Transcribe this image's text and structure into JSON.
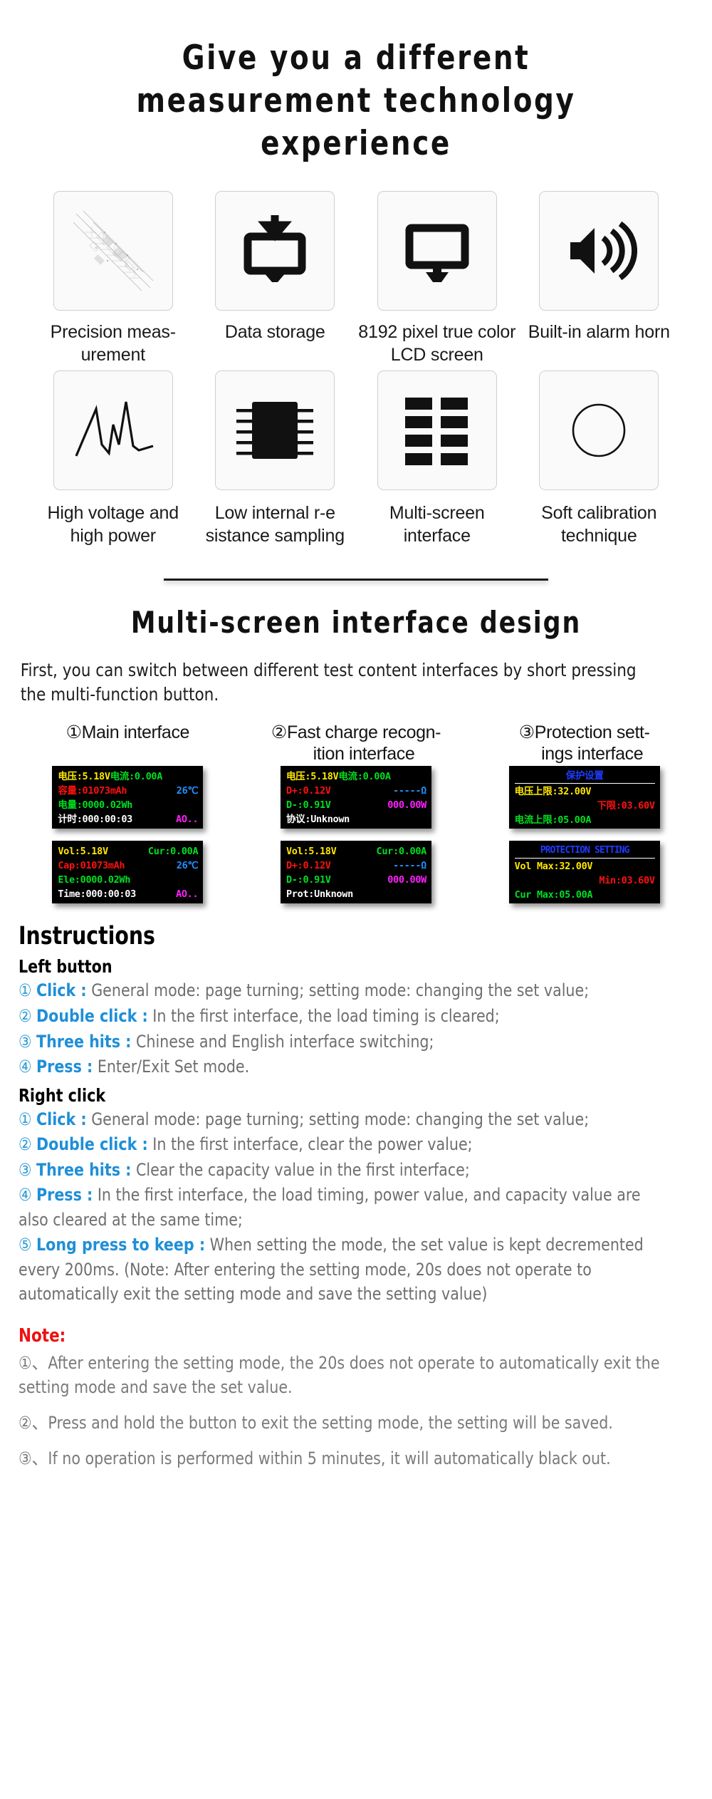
{
  "hero": {
    "title": "Give you a different measurement technology experience"
  },
  "features": [
    {
      "icon": "schematic-drawing-icon",
      "label": "Precision meas-\nurement"
    },
    {
      "icon": "monitor-download-icon",
      "label": "Data storage"
    },
    {
      "icon": "monitor-icon",
      "label": "8192 pixel true\ncolor LCD screen"
    },
    {
      "icon": "speaker-alarm-icon",
      "label": "Built-in alarm\nhorn"
    },
    {
      "icon": "waveform-chart-icon",
      "label": "High voltage and\nhigh power"
    },
    {
      "icon": "ic-chip-icon",
      "label": "Low internal r-e\nsistance sampling"
    },
    {
      "icon": "grid-tiles-icon",
      "label": "Multi-screen\ninterface"
    },
    {
      "icon": "circle-outline-icon",
      "label": "Soft calibration\ntechnique"
    }
  ],
  "section2": {
    "title": "Multi-screen interface design",
    "intro": "First, you can switch between different test content interfaces by short pressing the multi-function button."
  },
  "screens": [
    {
      "number": "①",
      "heading": "Main interface",
      "cn": {
        "rows": [
          {
            "cells": [
              {
                "text": "电压:5.18V",
                "color": "yellow"
              },
              {
                "text": "电流:0.00A",
                "color": "green"
              }
            ]
          },
          {
            "cells": [
              {
                "text": "容量:01073mAh",
                "color": "red"
              },
              {
                "text": "26℃",
                "color": "blue"
              }
            ]
          },
          {
            "cells": [
              {
                "text": "电量:0000.02Wh",
                "color": "green"
              }
            ]
          },
          {
            "cells": [
              {
                "text": "计时:000:00:03",
                "color": "white"
              },
              {
                "text": "AO..",
                "color": "magenta"
              }
            ]
          }
        ]
      },
      "en": {
        "rows": [
          {
            "cells": [
              {
                "text": "Vol:5.18V",
                "color": "yellow"
              },
              {
                "text": "Cur:0.00A",
                "color": "green"
              }
            ]
          },
          {
            "cells": [
              {
                "text": "Cap:01073mAh",
                "color": "red"
              },
              {
                "text": "26℃",
                "color": "blue"
              }
            ]
          },
          {
            "cells": [
              {
                "text": "Ele:0000.02Wh",
                "color": "green"
              }
            ]
          },
          {
            "cells": [
              {
                "text": "Time:000:00:03",
                "color": "white"
              },
              {
                "text": "AO..",
                "color": "magenta"
              }
            ]
          }
        ]
      }
    },
    {
      "number": "②",
      "heading": "Fast charge recogn-\nition interface",
      "cn": {
        "rows": [
          {
            "cells": [
              {
                "text": "电压:5.18V",
                "color": "yellow"
              },
              {
                "text": "电流:0.00A",
                "color": "green"
              }
            ]
          },
          {
            "cells": [
              {
                "text": "D+:0.12V",
                "color": "red"
              },
              {
                "text": "-----Ω",
                "color": "blue"
              }
            ]
          },
          {
            "cells": [
              {
                "text": "D-:0.91V",
                "color": "green"
              },
              {
                "text": "000.00W",
                "color": "magenta"
              }
            ]
          },
          {
            "cells": [
              {
                "text": "协议:Unknown",
                "color": "white"
              }
            ]
          }
        ]
      },
      "en": {
        "rows": [
          {
            "cells": [
              {
                "text": "Vol:5.18V",
                "color": "yellow"
              },
              {
                "text": "Cur:0.00A",
                "color": "green"
              }
            ]
          },
          {
            "cells": [
              {
                "text": "D+:0.12V",
                "color": "red"
              },
              {
                "text": "-----Ω",
                "color": "blue"
              }
            ]
          },
          {
            "cells": [
              {
                "text": "D-:0.91V",
                "color": "green"
              },
              {
                "text": "000.00W",
                "color": "magenta"
              }
            ]
          },
          {
            "cells": [
              {
                "text": "Prot:Unknown",
                "color": "white"
              }
            ]
          }
        ]
      }
    },
    {
      "number": "③",
      "heading": "Protection sett-\nings interface",
      "cn": {
        "title": "保护设置",
        "rows": [
          {
            "cells": [
              {
                "text": "电压上限:32.00V",
                "color": "yellow"
              }
            ]
          },
          {
            "cells": [
              {
                "text": "下限:03.60V",
                "color": "red",
                "align": "right"
              }
            ]
          },
          {
            "cells": [
              {
                "text": "电流上限:05.00A",
                "color": "green"
              }
            ]
          }
        ]
      },
      "en": {
        "title": "PROTECTION SETTING",
        "rows": [
          {
            "cells": [
              {
                "text": "Vol Max:32.00V",
                "color": "yellow"
              }
            ]
          },
          {
            "cells": [
              {
                "text": "Min:03.60V",
                "color": "red",
                "align": "right"
              }
            ]
          },
          {
            "cells": [
              {
                "text": "Cur Max:05.00A",
                "color": "green"
              }
            ]
          }
        ]
      }
    }
  ],
  "instructions": {
    "title": "Instructions",
    "groups": [
      {
        "heading": "Left button",
        "items": [
          {
            "marker": "①",
            "key": "Click :",
            "text": " General mode: page turning; setting mode: changing the set value;"
          },
          {
            "marker": "②",
            "key": "Double click :",
            "text": " In the first interface, the load timing is cleared;"
          },
          {
            "marker": "③",
            "key": "Three hits :",
            "text": " Chinese and English interface switching;"
          },
          {
            "marker": "④",
            "key": "Press :",
            "text": " Enter/Exit Set mode."
          }
        ]
      },
      {
        "heading": "Right click",
        "items": [
          {
            "marker": "①",
            "key": "Click :",
            "text": " General mode: page turning; setting mode: changing the set value;"
          },
          {
            "marker": "②",
            "key": "Double click :",
            "text": " In the first interface, clear the power value;"
          },
          {
            "marker": "③",
            "key": "Three hits :",
            "text": " Clear the capacity value in the first interface;"
          },
          {
            "marker": "④",
            "key": "Press :",
            "text": " In the first interface, the load timing, power value, and capacity value are also cleared at the same time;"
          },
          {
            "marker": "⑤",
            "key": "Long press to keep :",
            "text": " When setting the mode, the set value is kept decremented every 200ms. (Note: After entering the setting mode, 20s does not operate to automatically exit the setting mode and save the setting value)"
          }
        ]
      }
    ]
  },
  "note": {
    "title": "Note:",
    "items": [
      "①、After entering the setting mode, the 20s does not operate to automatically exit the setting mode and save the set value.",
      "②、Press and hold the button to exit the setting mode, the setting will be saved.",
      "③、If no operation is performed within 5 minutes, it will automatically black out."
    ]
  },
  "colors": {
    "accent_blue": "#1f8fd8",
    "note_red": "#ee1111",
    "lcd_background": "#000000"
  }
}
